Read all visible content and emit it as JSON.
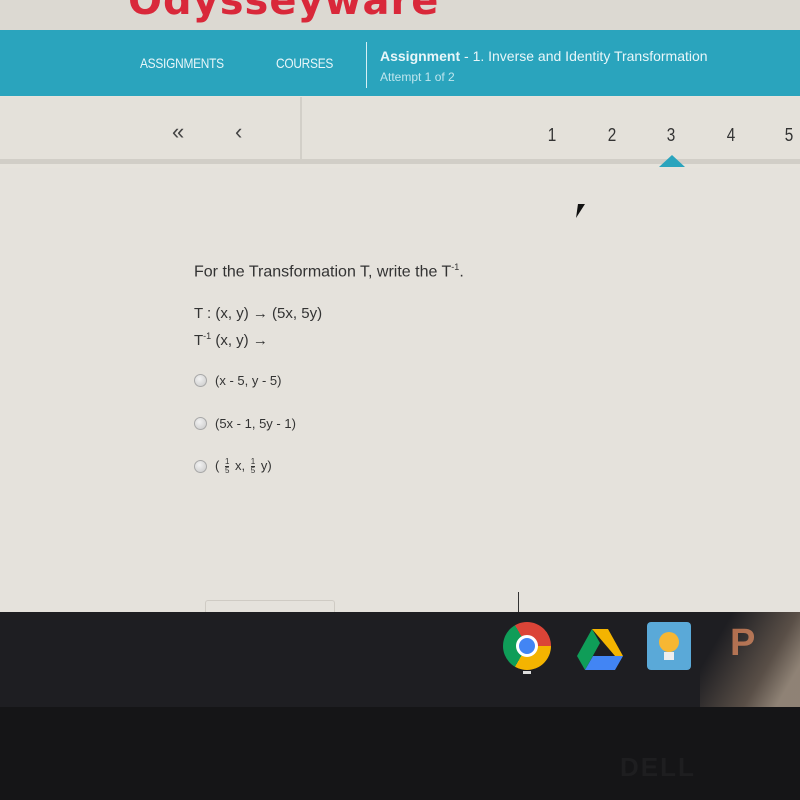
{
  "brand": {
    "logo_text": "Odysseyware",
    "color": "#d9283a"
  },
  "nav": {
    "accent": "#2aa4bd",
    "items": [
      {
        "label": "ASSIGNMENTS"
      },
      {
        "label": "COURSES"
      }
    ],
    "assignment": {
      "label": "Assignment",
      "title": "- 1. Inverse and Identity Transformation",
      "attempt": "Attempt 1 of 2"
    }
  },
  "pager": {
    "first_icon": "«",
    "prev_icon": "‹",
    "pages": [
      "1",
      "2",
      "3",
      "4",
      "5"
    ],
    "current_page": "3"
  },
  "question": {
    "prompt": "For the Transformation T, write the T",
    "prompt_sup": "-1",
    "prompt_end": ".",
    "line1": "T : (x, y) → (5x, 5y)",
    "line2_main": "T",
    "line2_sup": "-1",
    "line2_rest": " (x, y) →",
    "options": [
      {
        "label": "(x - 5, y - 5)"
      },
      {
        "label": "(5x - 1, 5y - 1)"
      },
      {
        "label_open": "(",
        "frac_num": "1",
        "frac_den": "5",
        "mid": "x,",
        "frac2_num": "1",
        "frac2_den": "5",
        "label_close": "y)"
      }
    ]
  },
  "shelf": {
    "apps": [
      {
        "name": "Chrome",
        "icon": "chrome-icon"
      },
      {
        "name": "Google Drive",
        "icon": "drive-icon"
      },
      {
        "name": "Keep",
        "icon": "lightbulb-icon"
      },
      {
        "name": "P app",
        "icon": "p-icon",
        "glyph": "P"
      }
    ]
  },
  "bezel": {
    "brand": "DELL"
  }
}
